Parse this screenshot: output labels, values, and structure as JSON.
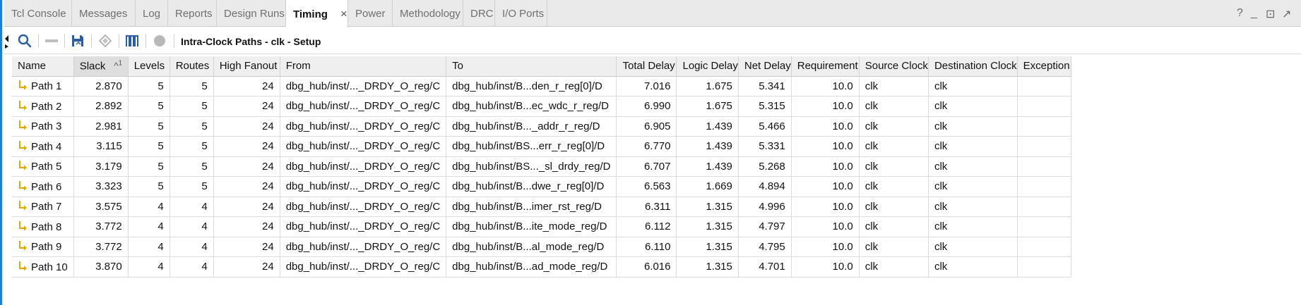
{
  "tabs": [
    {
      "label": "Tcl Console"
    },
    {
      "label": "Messages"
    },
    {
      "label": "Log"
    },
    {
      "label": "Reports"
    },
    {
      "label": "Design Runs"
    },
    {
      "label": "Timing",
      "active": true
    },
    {
      "label": "Power"
    },
    {
      "label": "Methodology"
    },
    {
      "label": "DRC"
    },
    {
      "label": "I/O Ports"
    }
  ],
  "window_controls": {
    "help": "?",
    "minimize": "_",
    "restore": "⊡",
    "float": "↗"
  },
  "toolbar": {
    "title": "Intra-Clock Paths - clk - Setup",
    "icons": [
      "collapse-arrow-icon",
      "search-icon",
      "minus-icon",
      "save-icon",
      "diamond-icon",
      "waveform-icon",
      "circle-icon"
    ]
  },
  "table": {
    "columns": [
      "Name",
      "Slack",
      "Levels",
      "Routes",
      "High Fanout",
      "From",
      "To",
      "Total Delay",
      "Logic Delay",
      "Net Delay",
      "Requirement",
      "Source Clock",
      "Destination Clock",
      "Exception"
    ],
    "sort": {
      "column": "Slack",
      "indicator": "^",
      "order": "1"
    },
    "rows": [
      [
        "Path 1",
        "2.870",
        "5",
        "5",
        "24",
        "dbg_hub/inst/..._DRDY_O_reg/C",
        "dbg_hub/inst/B...den_r_reg[0]/D",
        "7.016",
        "1.675",
        "5.341",
        "10.0",
        "clk",
        "clk",
        ""
      ],
      [
        "Path 2",
        "2.892",
        "5",
        "5",
        "24",
        "dbg_hub/inst/..._DRDY_O_reg/C",
        "dbg_hub/inst/B...ec_wdc_r_reg/D",
        "6.990",
        "1.675",
        "5.315",
        "10.0",
        "clk",
        "clk",
        ""
      ],
      [
        "Path 3",
        "2.981",
        "5",
        "5",
        "24",
        "dbg_hub/inst/..._DRDY_O_reg/C",
        "dbg_hub/inst/B..._addr_r_reg/D",
        "6.905",
        "1.439",
        "5.466",
        "10.0",
        "clk",
        "clk",
        ""
      ],
      [
        "Path 4",
        "3.115",
        "5",
        "5",
        "24",
        "dbg_hub/inst/..._DRDY_O_reg/C",
        "dbg_hub/inst/BS...err_r_reg[0]/D",
        "6.770",
        "1.439",
        "5.331",
        "10.0",
        "clk",
        "clk",
        ""
      ],
      [
        "Path 5",
        "3.179",
        "5",
        "5",
        "24",
        "dbg_hub/inst/..._DRDY_O_reg/C",
        "dbg_hub/inst/BS..._sl_drdy_reg/D",
        "6.707",
        "1.439",
        "5.268",
        "10.0",
        "clk",
        "clk",
        ""
      ],
      [
        "Path 6",
        "3.323",
        "5",
        "5",
        "24",
        "dbg_hub/inst/..._DRDY_O_reg/C",
        "dbg_hub/inst/B...dwe_r_reg[0]/D",
        "6.563",
        "1.669",
        "4.894",
        "10.0",
        "clk",
        "clk",
        ""
      ],
      [
        "Path 7",
        "3.575",
        "4",
        "4",
        "24",
        "dbg_hub/inst/..._DRDY_O_reg/C",
        "dbg_hub/inst/B...imer_rst_reg/D",
        "6.311",
        "1.315",
        "4.996",
        "10.0",
        "clk",
        "clk",
        ""
      ],
      [
        "Path 8",
        "3.772",
        "4",
        "4",
        "24",
        "dbg_hub/inst/..._DRDY_O_reg/C",
        "dbg_hub/inst/B...ite_mode_reg/D",
        "6.112",
        "1.315",
        "4.797",
        "10.0",
        "clk",
        "clk",
        ""
      ],
      [
        "Path 9",
        "3.772",
        "4",
        "4",
        "24",
        "dbg_hub/inst/..._DRDY_O_reg/C",
        "dbg_hub/inst/B...al_mode_reg/D",
        "6.110",
        "1.315",
        "4.795",
        "10.0",
        "clk",
        "clk",
        ""
      ],
      [
        "Path 10",
        "3.870",
        "4",
        "4",
        "24",
        "dbg_hub/inst/..._DRDY_O_reg/C",
        "dbg_hub/inst/B...ad_mode_reg/D",
        "6.016",
        "1.315",
        "4.701",
        "10.0",
        "clk",
        "clk",
        ""
      ]
    ]
  },
  "colors": {
    "accent": "#1d7fd9",
    "path_icon": "#e0a800",
    "toolbar_icon": "#2a5da8"
  }
}
